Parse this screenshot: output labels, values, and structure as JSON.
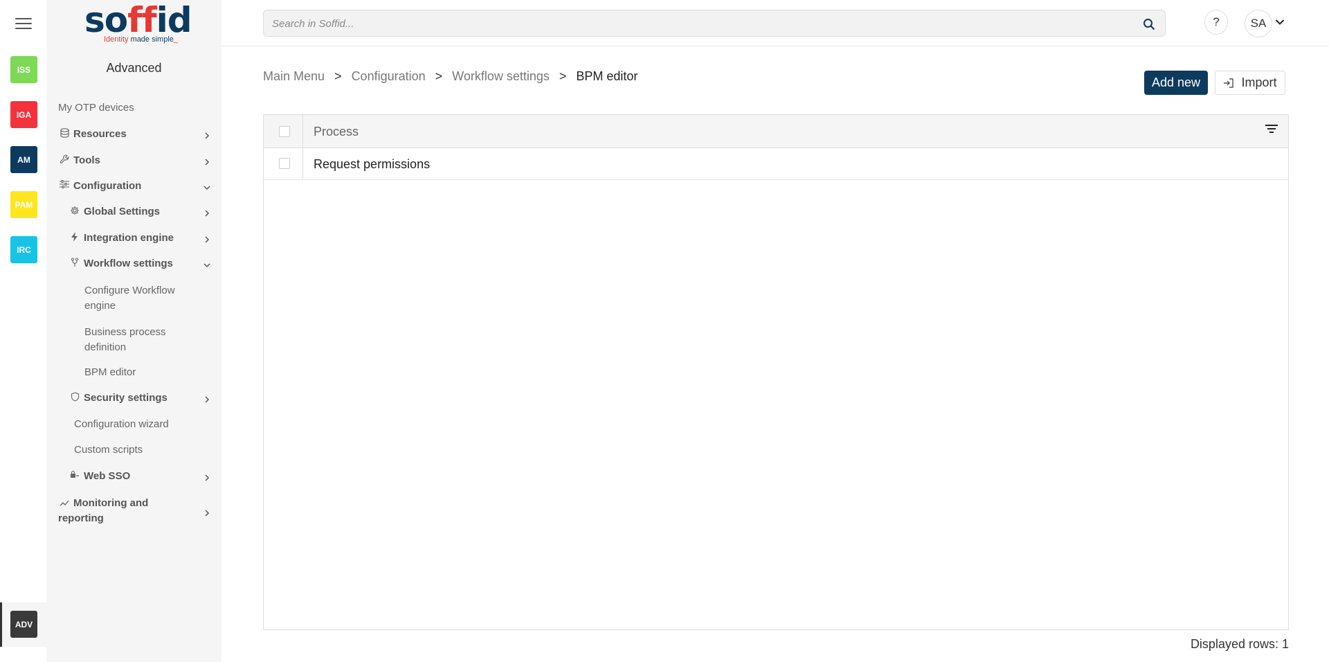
{
  "rail": {
    "apps": [
      {
        "code": "ISS",
        "color": "#7ed957"
      },
      {
        "code": "IGA",
        "color": "#f4323c"
      },
      {
        "code": "AM",
        "color": "#0e3a5e"
      },
      {
        "code": "PAM",
        "color": "#ffe51e"
      },
      {
        "code": "IRC",
        "color": "#19c3e6"
      }
    ],
    "active": {
      "code": "ADV",
      "color": "#3a3a3a"
    }
  },
  "logo": {
    "word_a": "so",
    "word_b": "ff",
    "word_c": "id",
    "tag_a": "Identity",
    "tag_b": " made simple",
    "tag_c": "_"
  },
  "sidebar": {
    "title": "Advanced",
    "items": {
      "otp": "My OTP devices",
      "resources": "Resources",
      "tools": "Tools",
      "configuration": "Configuration",
      "global": "Global Settings",
      "integration": "Integration engine",
      "workflow": "Workflow settings",
      "configure_workflow": "Configure Workflow engine",
      "business_process": "Business process definition",
      "bpm_editor": "BPM editor",
      "security": "Security settings",
      "wizard": "Configuration wizard",
      "scripts": "Custom scripts",
      "websso": "Web SSO",
      "monitoring": "Monitoring and reporting"
    }
  },
  "header": {
    "search_placeholder": "Search in Soffid...",
    "help": "?",
    "user_initials": "SA"
  },
  "breadcrumb": {
    "items": [
      "Main Menu",
      "Configuration",
      "Workflow settings"
    ],
    "current": "BPM editor",
    "separator": ">"
  },
  "toolbar": {
    "add_label": "Add new",
    "import_label": "Import"
  },
  "table": {
    "columns": [
      "Process"
    ],
    "rows": [
      "Request permissions"
    ]
  },
  "footer": {
    "displayed_rows": "Displayed rows: 1"
  }
}
